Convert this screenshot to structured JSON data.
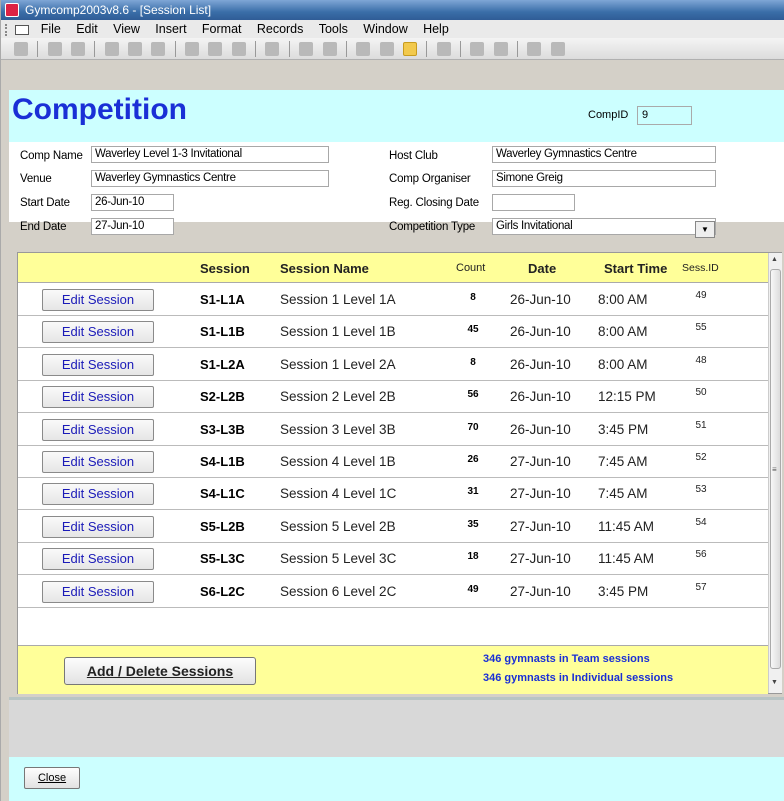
{
  "window": {
    "title": "Gymcomp2003v8.6 - [Session List]"
  },
  "menu": [
    "File",
    "Edit",
    "View",
    "Insert",
    "Format",
    "Records",
    "Tools",
    "Window",
    "Help"
  ],
  "form": {
    "title": "Competition",
    "comp_id_label": "CompID",
    "comp_id": "9",
    "comp_name_label": "Comp Name",
    "comp_name": "Waverley Level 1-3 Invitational",
    "venue_label": "Venue",
    "venue": "Waverley Gymnastics Centre",
    "start_date_label": "Start Date",
    "start_date": "26-Jun-10",
    "end_date_label": "End Date",
    "end_date": "27-Jun-10",
    "host_club_label": "Host Club",
    "host_club": "Waverley Gymnastics Centre",
    "comp_organiser_label": "Comp Organiser",
    "comp_organiser": "Simone Greig",
    "reg_closing_label": "Reg. Closing Date",
    "reg_closing": "",
    "comp_type_label": "Competition Type",
    "comp_type": "Girls Invitational"
  },
  "sessions": {
    "headers": {
      "session": "Session",
      "name": "Session Name",
      "count": "Count",
      "date": "Date",
      "start": "Start Time",
      "sid": "Sess.ID"
    },
    "edit_label": "Edit Session",
    "rows": [
      {
        "code": "S1-L1A",
        "name": "Session 1 Level 1A",
        "count": "8",
        "date": "26-Jun-10",
        "time": "8:00 AM",
        "sid": "49"
      },
      {
        "code": "S1-L1B",
        "name": "Session 1 Level 1B",
        "count": "45",
        "date": "26-Jun-10",
        "time": "8:00 AM",
        "sid": "55"
      },
      {
        "code": "S1-L2A",
        "name": "Session 1 Level 2A",
        "count": "8",
        "date": "26-Jun-10",
        "time": "8:00 AM",
        "sid": "48"
      },
      {
        "code": "S2-L2B",
        "name": "Session 2 Level 2B",
        "count": "56",
        "date": "26-Jun-10",
        "time": "12:15 PM",
        "sid": "50"
      },
      {
        "code": "S3-L3B",
        "name": "Session 3 Level 3B",
        "count": "70",
        "date": "26-Jun-10",
        "time": "3:45 PM",
        "sid": "51"
      },
      {
        "code": "S4-L1B",
        "name": "Session 4 Level 1B",
        "count": "26",
        "date": "27-Jun-10",
        "time": "7:45 AM",
        "sid": "52"
      },
      {
        "code": "S4-L1C",
        "name": "Session 4 Level 1C",
        "count": "31",
        "date": "27-Jun-10",
        "time": "7:45 AM",
        "sid": "53"
      },
      {
        "code": "S5-L2B",
        "name": "Session 5 Level 2B",
        "count": "35",
        "date": "27-Jun-10",
        "time": "11:45 AM",
        "sid": "54"
      },
      {
        "code": "S5-L3C",
        "name": "Session 5 Level 3C",
        "count": "18",
        "date": "27-Jun-10",
        "time": "11:45 AM",
        "sid": "56"
      },
      {
        "code": "S6-L2C",
        "name": "Session 6 Level 2C",
        "count": "49",
        "date": "27-Jun-10",
        "time": "3:45 PM",
        "sid": "57"
      }
    ],
    "add_delete_label": "Add / Delete Sessions",
    "team_total": "346  gymnasts in Team sessions",
    "individual_total": "346  gymnasts in Individual sessions"
  },
  "close_label": "Close"
}
